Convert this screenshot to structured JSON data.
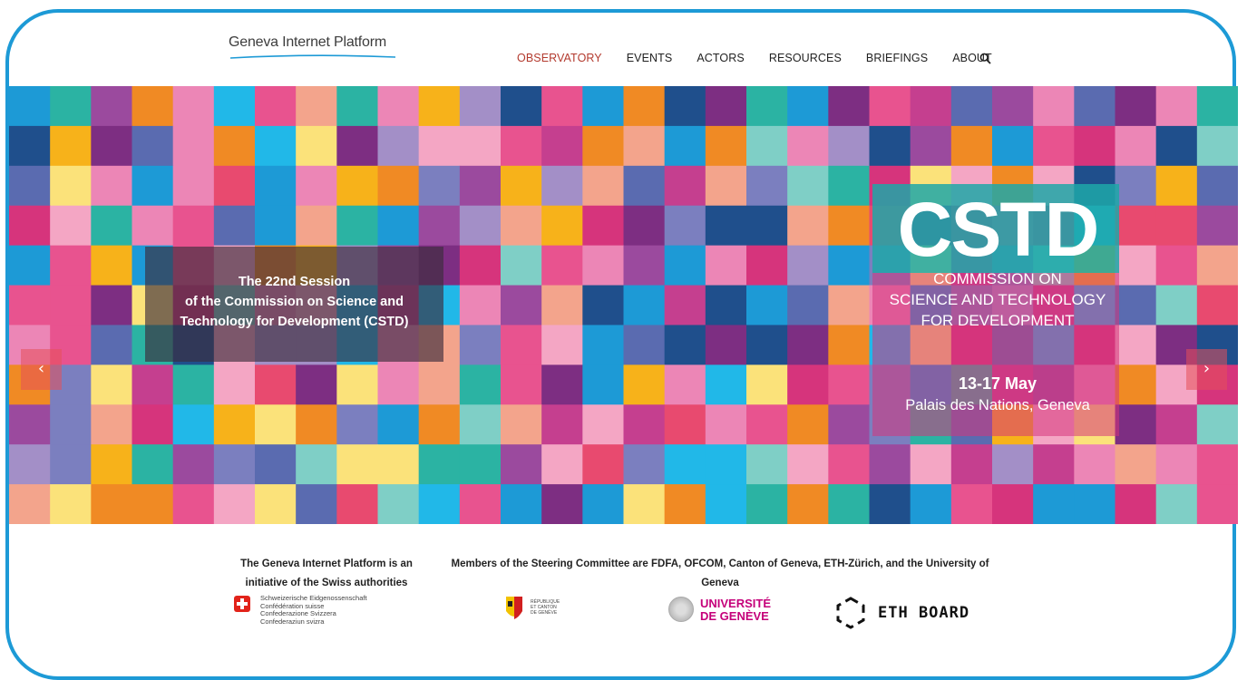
{
  "header": {
    "logo_text": "Geneva Internet Platform",
    "nav": [
      {
        "label": "OBSERVATORY",
        "active": true
      },
      {
        "label": "EVENTS",
        "active": false
      },
      {
        "label": "ACTORS",
        "active": false
      },
      {
        "label": "RESOURCES",
        "active": false
      },
      {
        "label": "BRIEFINGS",
        "active": false
      },
      {
        "label": "ABOUT",
        "active": false
      }
    ],
    "search_icon": "search-icon"
  },
  "hero": {
    "caption_lines": [
      "The 22nd Session",
      "of the Commission on Science and",
      "Technology for Development (CSTD)"
    ],
    "banner": {
      "title": "CSTD",
      "subtitle_lines": [
        "COMMISSION ON",
        "SCIENCE AND TECHNOLOGY",
        "FOR DEVELOPMENT"
      ],
      "date": "13-17 May",
      "venue": "Palais des Nations, Geneva"
    },
    "prev_icon": "chevron-left-icon",
    "next_icon": "chevron-right-icon",
    "prev_glyph": "‹",
    "next_glyph": "›"
  },
  "footer": {
    "left_text": "The Geneva Internet Platform is an initiative of the Swiss authorities",
    "right_text": "Members of the Steering Committee are FDFA, OFCOM, Canton of Geneva, ETH-Zürich, and the University of Geneva",
    "swiss_lines": [
      "Schweizerische Eidgenossenschaft",
      "Confédération suisse",
      "Confederazione Svizzera",
      "Confederaziun svizra"
    ],
    "geneva_lines": [
      "RÉPUBLIQUE",
      "ET CANTON",
      "DE GENÈVE"
    ],
    "unige_lines": [
      "UNIVERSITÉ",
      "DE GENÈVE"
    ],
    "eth_text": "ETH BOARD"
  },
  "colors": {
    "accent_nav": "#b33a2e",
    "frame_border": "#1d9ad6"
  }
}
